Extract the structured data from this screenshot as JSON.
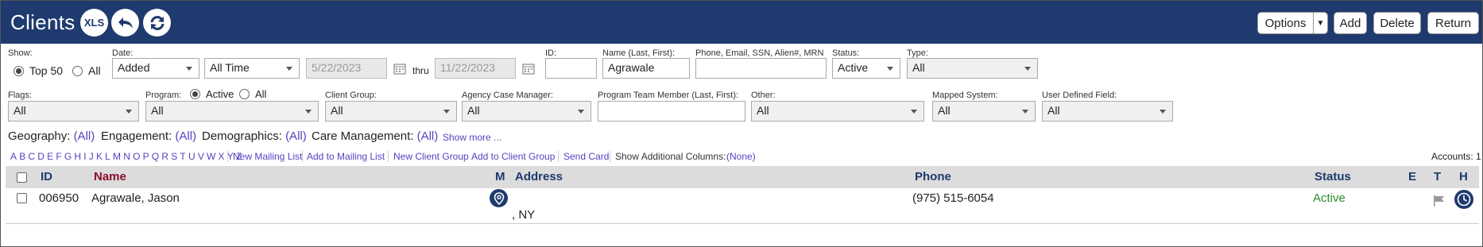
{
  "header": {
    "title": "Clients",
    "xls_label": "XLS",
    "buttons": {
      "options": "Options",
      "add": "Add",
      "delete": "Delete",
      "return": "Return"
    }
  },
  "filters": {
    "show": {
      "label": "Show:",
      "options": [
        "Top 50",
        "All"
      ],
      "selected": "Top 50"
    },
    "date": {
      "label": "Date:",
      "field": "Added",
      "range": "All Time",
      "from": "5/22/2023",
      "thru_label": "thru",
      "to": "11/22/2023"
    },
    "id": {
      "label": "ID:",
      "value": ""
    },
    "name": {
      "label": "Name (Last, First):",
      "value": "Agrawale"
    },
    "phone": {
      "label": "Phone, Email, SSN, Alien#, MRN",
      "value": ""
    },
    "status": {
      "label": "Status:",
      "value": "Active"
    },
    "type": {
      "label": "Type:",
      "value": "All"
    },
    "flags": {
      "label": "Flags:",
      "value": "All"
    },
    "program": {
      "label": "Program:",
      "options": [
        "Active",
        "All"
      ],
      "selected": "Active",
      "value": "All"
    },
    "client_group": {
      "label": "Client Group:",
      "value": "All"
    },
    "agency_case_manager": {
      "label": "Agency Case Manager:",
      "value": "All"
    },
    "program_team_member": {
      "label": "Program Team Member (Last, First):",
      "value": ""
    },
    "other": {
      "label": "Other:",
      "value": "All"
    },
    "mapped_system": {
      "label": "Mapped System:",
      "value": "All"
    },
    "user_defined_field": {
      "label": "User Defined Field:",
      "value": "All"
    }
  },
  "categories": {
    "geography": {
      "label": "Geography:",
      "value": "(All)"
    },
    "engagement": {
      "label": "Engagement:",
      "value": "(All)"
    },
    "demographics": {
      "label": "Demographics:",
      "value": "(All)"
    },
    "care_management": {
      "label": "Care Management:",
      "value": "(All)"
    },
    "show_more": "Show more ..."
  },
  "alphabet": [
    "A",
    "B",
    "C",
    "D",
    "E",
    "F",
    "G",
    "H",
    "I",
    "J",
    "K",
    "L",
    "M",
    "N",
    "O",
    "P",
    "Q",
    "R",
    "S",
    "T",
    "U",
    "V",
    "W",
    "X",
    "Y",
    "Z"
  ],
  "actions": {
    "new_mailing_list": "New Mailing List",
    "add_to_mailing_list": "Add to Mailing List",
    "new_client_group": "New Client Group",
    "add_to_client_group": "Add to Client Group",
    "send_card": "Send Card",
    "show_additional_columns": "Show Additional Columns:",
    "additional_columns_value": "(None)",
    "accounts": "Accounts: 1"
  },
  "table": {
    "columns": {
      "id": "ID",
      "name": "Name",
      "m": "M",
      "address": "Address",
      "phone": "Phone",
      "status": "Status",
      "e": "E",
      "t": "T",
      "h": "H"
    },
    "rows": [
      {
        "id": "006950",
        "name": "Agrawale, Jason",
        "address": ", NY",
        "phone": "(975) 515-6054",
        "status": "Active"
      }
    ]
  },
  "colors": {
    "header_bg": "#1e3a6e",
    "link": "#5a3fc0",
    "name_header": "#8b0d2e",
    "status_active": "#2e8b2e"
  }
}
